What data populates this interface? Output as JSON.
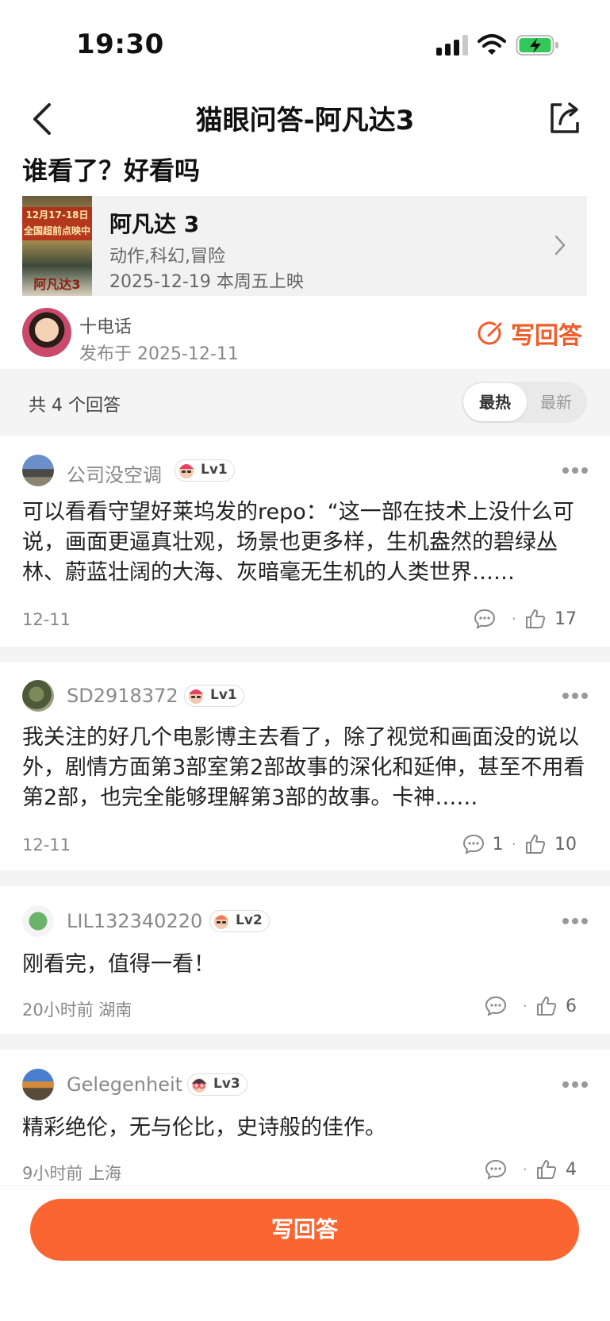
{
  "status_bar": {
    "time": "19:30"
  },
  "nav": {
    "title": "猫眼问答-阿凡达3"
  },
  "question": {
    "title": "谁看了？好看吗"
  },
  "movie": {
    "name": "阿凡达 3",
    "genre": "动作,科幻,冒险",
    "release": "2025-12-19 本周五上映",
    "poster_text": "12月17-18日 全国超前点映中",
    "poster_title": "阿凡达3"
  },
  "asker": {
    "name": "十电话",
    "date": "发布于 2025-12-11"
  },
  "write_answer_link": "写回答",
  "summary": {
    "count": "共 4 个回答",
    "sort_hot": "最热",
    "sort_new": "最新"
  },
  "answers": [
    {
      "user": "公司没空调",
      "level": "Lv1",
      "text": "可以看看守望好莱坞发的repo：“这一部在技术上没什么可说，画面更逼真壮观，场景也更多样，生机盎然的碧绿丛林、蔚蓝壮阔的大海、灰暗毫无生机的人类世界……",
      "time": "12-11",
      "comments": "",
      "likes": "17"
    },
    {
      "user": "SD2918372",
      "level": "Lv1",
      "text": "我关注的好几个电影博主去看了，除了视觉和画面没的说以外，剧情方面第3部室第2部故事的深化和延伸，甚至不用看第2部，也完全能够理解第3部的故事。卡神……",
      "time": "12-11",
      "comments": "1",
      "likes": "10"
    },
    {
      "user": "LIL132340220",
      "level": "Lv2",
      "text": "刚看完，值得一看！",
      "time": "20小时前  湖南",
      "comments": "",
      "likes": "6"
    },
    {
      "user": "Gelegenheit",
      "level": "Lv3",
      "text": "精彩绝伦，无与伦比，史诗般的佳作。",
      "time": "9小时前  上海",
      "comments": "",
      "likes": "4"
    }
  ],
  "bottom": {
    "write_answer_button": "写回答"
  },
  "colors": {
    "accent": "#fb6531",
    "link": "#f25c2b",
    "divider": "#f4f4f4"
  }
}
